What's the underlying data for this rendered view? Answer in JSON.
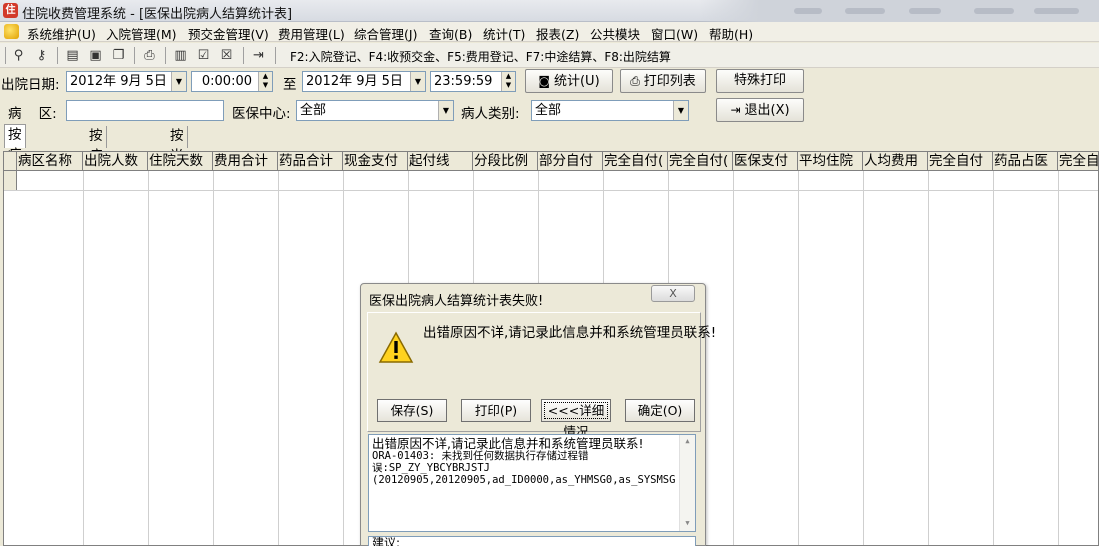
{
  "window": {
    "title": "住院收费管理系统 - [医保出院病人结算统计表]"
  },
  "menu": {
    "items": [
      "系统维护(U)",
      "入院管理(M)",
      "预交金管理(V)",
      "费用管理(L)",
      "综合管理(J)",
      "查询(B)",
      "统计(T)",
      "报表(Z)",
      "公共模块",
      "窗口(W)",
      "帮助(H)"
    ]
  },
  "toolbar": {
    "hint": "F2:入院登记、F4:收预交金、F5:费用登记、F7:中途结算、F8:出院结算",
    "icons": [
      "users-key-icon",
      "key-icon",
      "document-icon",
      "monitor-icon",
      "copy-icon",
      "print-icon",
      "card-icon",
      "check-doc-icon",
      "cancel-doc-icon",
      "exit-door-icon"
    ]
  },
  "filters": {
    "date_label": "出院日期:",
    "start_date": "2012年  9月  5日",
    "start_time": "0:00:00",
    "to_label": "至",
    "end_date": "2012年  9月  5日",
    "end_time": "23:59:59",
    "ward_label": "病    区:",
    "ward_value": "",
    "center_label": "医保中心:",
    "center_value": "全部",
    "patient_type_label": "病人类别:",
    "patient_type_value": "全部"
  },
  "buttons": {
    "stats": "统计(U)",
    "print_list": "打印列表",
    "special_print": "特殊打印",
    "exit": "退出(X)"
  },
  "tabs": [
    "按病区汇总",
    "按病人显示",
    "按当前科室汇总"
  ],
  "grid": {
    "columns": [
      "病区名称",
      "出院人数",
      "住院天数",
      "费用合计",
      "药品合计",
      "现金支付",
      "起付线",
      "分段比例",
      "部分自付",
      "完全自付(",
      "完全自付(",
      "医保支付",
      "平均住院",
      "人均费用",
      "完全自付",
      "药品占医",
      "完全自"
    ]
  },
  "dialog": {
    "title": "医保出院病人结算统计表失败!",
    "close": "X",
    "message": "出错原因不详,请记录此信息并和系统管理员联系!",
    "buttons": {
      "save": "保存(S)",
      "print": "打印(P)",
      "details": "<<<详细情况",
      "ok": "确定(O)"
    },
    "detail_line1": "出错原因不详,请记录此信息并和系统管理员联系!",
    "detail_line2": "ORA-01403: 未找到任何数据执行存储过程错",
    "detail_line3": "误:SP_ZY_YBCYBRJSTJ",
    "detail_line4": "(20120905,20120905,ad_ID0000,as_YHMSG0,as_SYSMSG",
    "suggest": "建议:"
  }
}
